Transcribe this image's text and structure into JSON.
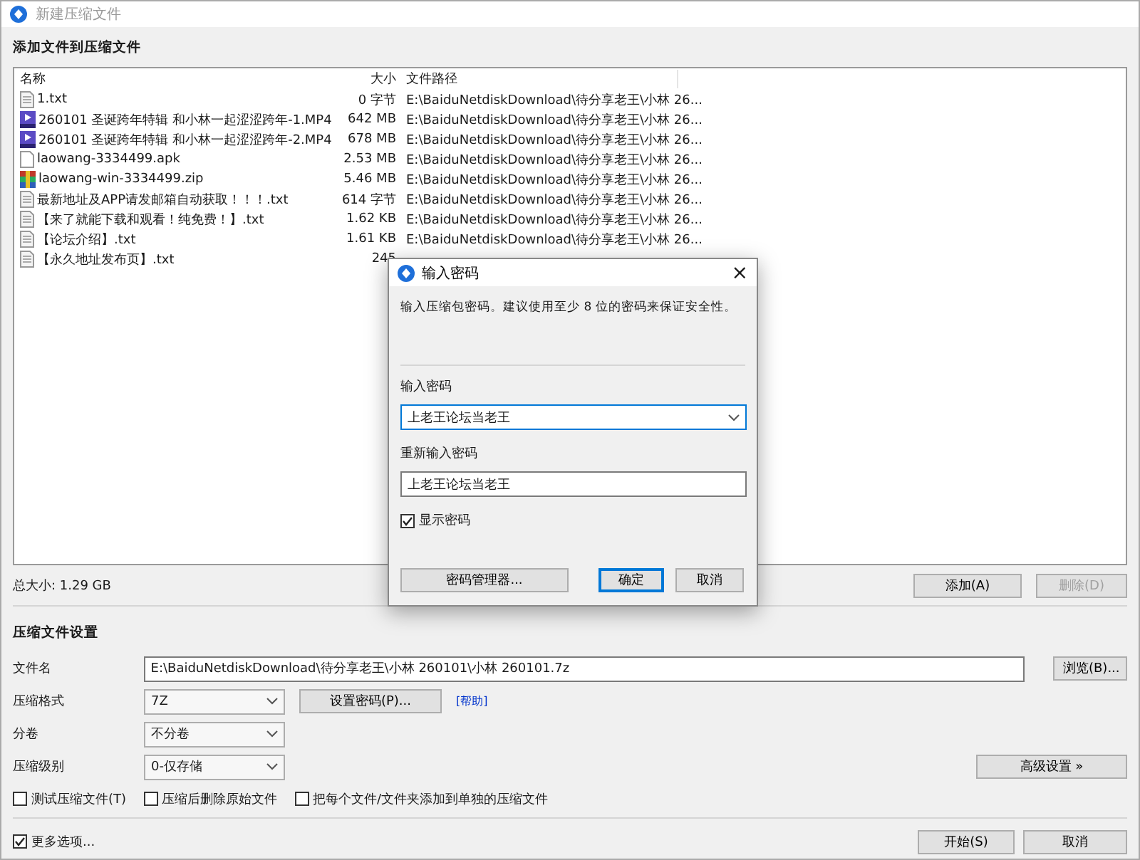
{
  "window": {
    "title": "新建压缩文件",
    "active": false
  },
  "add_section": {
    "title": "添加文件到压缩文件"
  },
  "file_table": {
    "columns": [
      "名称",
      "大小",
      "文件路径"
    ],
    "rows": [
      {
        "kind": "text",
        "name": "1.txt",
        "size": "0 字节",
        "path": "E:\\BaiduNetdiskDownload\\待分享老王\\小林 26..."
      },
      {
        "kind": "video",
        "name": "260101 圣诞跨年特辑 和小林一起涩涩跨年-1.MP4",
        "size": "642 MB",
        "path": "E:\\BaiduNetdiskDownload\\待分享老王\\小林 26..."
      },
      {
        "kind": "video",
        "name": "260101 圣诞跨年特辑 和小林一起涩涩跨年-2.MP4",
        "size": "678 MB",
        "path": "E:\\BaiduNetdiskDownload\\待分享老王\\小林 26..."
      },
      {
        "kind": "blank",
        "name": "laowang-3334499.apk",
        "size": "2.53 MB",
        "path": "E:\\BaiduNetdiskDownload\\待分享老王\\小林 26..."
      },
      {
        "kind": "archive",
        "name": "laowang-win-3334499.zip",
        "size": "5.46 MB",
        "path": "E:\\BaiduNetdiskDownload\\待分享老王\\小林 26..."
      },
      {
        "kind": "text",
        "name": "最新地址及APP请发邮箱自动获取！！！.txt",
        "size": "614 字节",
        "path": "E:\\BaiduNetdiskDownload\\待分享老王\\小林 26..."
      },
      {
        "kind": "text",
        "name": "【来了就能下载和观看！纯免费！】.txt",
        "size": "1.62 KB",
        "path": "E:\\BaiduNetdiskDownload\\待分享老王\\小林 26..."
      },
      {
        "kind": "text",
        "name": "【论坛介绍】.txt",
        "size": "1.61 KB",
        "path": "E:\\BaiduNetdiskDownload\\待分享老王\\小林 26..."
      },
      {
        "kind": "text",
        "name": "【永久地址发布页】.txt",
        "size": "245"
      }
    ]
  },
  "total_size": "总大小: 1.29 GB",
  "list_buttons": [
    {
      "label": "添加(A)",
      "disabled": false
    },
    {
      "label": "删除(D)",
      "disabled": true
    }
  ],
  "settings": {
    "title": "压缩文件设置",
    "filename": {
      "label": "文件名",
      "value": "E:\\BaiduNetdiskDownload\\待分享老王\\小林 260101\\小林 260101.7z",
      "button": "浏览(B)..."
    },
    "format": {
      "label": "压缩格式",
      "value": "7Z",
      "password_button": "设置密码(P)...",
      "help_link": "[帮助]"
    },
    "volume": {
      "label": "分卷",
      "value": "不分卷"
    },
    "level": {
      "label": "压缩级别",
      "value": "0-仅存储",
      "advanced_button": "高级设置 »"
    },
    "options": [
      {
        "label": "测试压缩文件(T)",
        "checked": false
      },
      {
        "label": "压缩后删除原始文件",
        "checked": false
      },
      {
        "label": "把每个文件/文件夹添加到单独的压缩文件",
        "checked": false
      }
    ]
  },
  "footer": {
    "more_options": {
      "label": "更多选项...",
      "checked": true
    },
    "buttons": [
      {
        "label": "开始(S)",
        "default": false
      },
      {
        "label": "取消",
        "default": false
      }
    ]
  },
  "password_dialog": {
    "title": "输入密码",
    "close": "×",
    "message": "输入压缩包密码。建议使用至少 8 位的密码来保证安全性。",
    "password_label": "输入密码",
    "password_value": "上老王论坛当老王",
    "confirm_label": "重新输入密码",
    "confirm_value": "上老王论坛当老王",
    "show_password": {
      "label": "显示密码",
      "checked": true
    },
    "buttons": [
      {
        "label": "密码管理器...",
        "default": false
      },
      {
        "label": "确定",
        "default": true
      },
      {
        "label": "取消",
        "default": false
      }
    ]
  }
}
